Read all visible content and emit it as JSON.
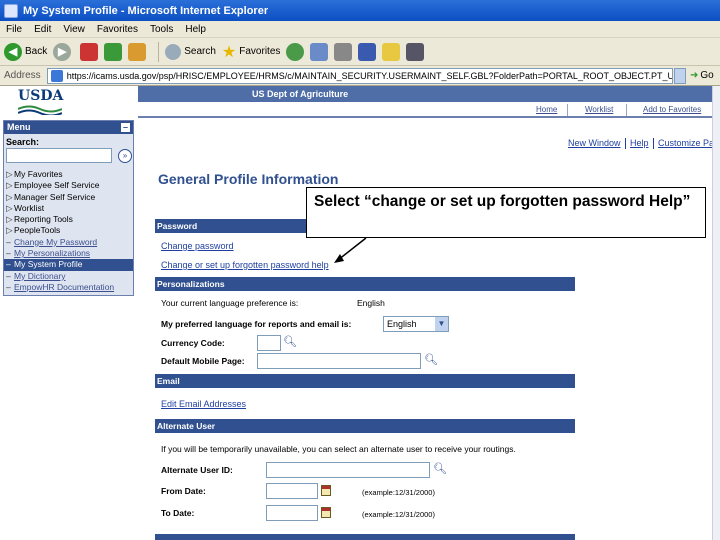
{
  "window": {
    "title": "My System Profile - Microsoft Internet Explorer"
  },
  "menubar": [
    "File",
    "Edit",
    "View",
    "Favorites",
    "Tools",
    "Help"
  ],
  "toolbar": {
    "back": "Back",
    "search": "Search",
    "favorites": "Favorites"
  },
  "address": {
    "label": "Address",
    "url": "https://icams.usda.gov/psp/HRISC/EMPLOYEE/HRMS/c/MAINTAIN_SECURITY.USERMAINT_SELF.GBL?FolderPath=PORTAL_ROOT_OBJECT.PT_USERMAINT_SELF_GBL&IsF",
    "go": "Go"
  },
  "header": {
    "logo": "USDA",
    "agency": "US Dept of Agriculture",
    "nav": [
      "Home",
      "Worklist",
      "Add to Favorites"
    ]
  },
  "menu": {
    "title": "Menu",
    "search_label": "Search:",
    "items": [
      {
        "label": "My Favorites",
        "marker": "▷"
      },
      {
        "label": "Employee Self Service",
        "marker": "▷"
      },
      {
        "label": "Manager Self Service",
        "marker": "▷"
      },
      {
        "label": "Worklist",
        "marker": "▷"
      },
      {
        "label": "Reporting Tools",
        "marker": "▷"
      },
      {
        "label": "PeopleTools",
        "marker": "▷"
      },
      {
        "label": "Change My Password",
        "marker": "–"
      },
      {
        "label": "My Personalizations",
        "marker": "–"
      },
      {
        "label": "My System Profile",
        "marker": "–"
      },
      {
        "label": "My Dictionary",
        "marker": "–"
      },
      {
        "label": "EmpowHR Documentation",
        "marker": "–"
      }
    ]
  },
  "page_links": [
    "New Window",
    "Help",
    "Customize Pag"
  ],
  "page_title": "General Profile Information",
  "password": {
    "heading": "Password",
    "change": "Change password",
    "forgot": "Change or set up forgotten password help"
  },
  "personalizations": {
    "heading": "Personalizations",
    "current_lang_label": "Your current language preference is:",
    "current_lang_value": "English",
    "pref_lang_label": "My preferred language for reports and email is:",
    "pref_lang_value": "English",
    "currency_label": "Currency Code:",
    "mobile_label": "Default Mobile Page:"
  },
  "email": {
    "heading": "Email",
    "edit": "Edit Email Addresses"
  },
  "alternate": {
    "heading": "Alternate User",
    "info": "If you will be temporarily unavailable, you can select an alternate user to receive your routings.",
    "user_label": "Alternate User ID:",
    "from_label": "From Date:",
    "to_label": "To Date:",
    "example": "(example:12/31/2000)"
  },
  "callout": {
    "text": "Select “change or set up forgotten password Help”"
  },
  "colors": {
    "brand": "#30508f",
    "banner": "#4f6ea8"
  }
}
